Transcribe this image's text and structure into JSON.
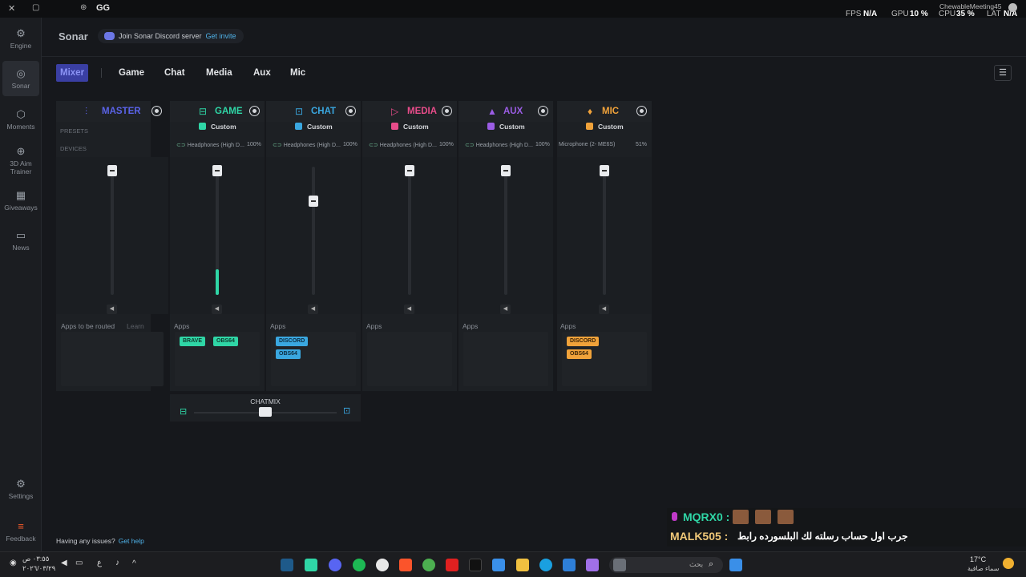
{
  "titlebar": {
    "app": "GG",
    "fps_label": "FPS",
    "fps_value": "N/A",
    "gpu_label": "GPU",
    "gpu_value": "10 %",
    "cpu_label": "CPU",
    "cpu_value": "35 %",
    "lat_label": "LAT",
    "lat_value": "N/A",
    "username": "ChewableMeeting45"
  },
  "sidebar": {
    "items": [
      {
        "label": "Engine"
      },
      {
        "label": "Sonar"
      },
      {
        "label": "Moments"
      },
      {
        "label": "3D Aim Trainer"
      },
      {
        "label": "Giveaways"
      },
      {
        "label": "News"
      },
      {
        "label": "Settings"
      },
      {
        "label": "Feedback"
      }
    ]
  },
  "header": {
    "title": "Sonar",
    "discord_text": "Join Sonar Discord server",
    "discord_link": "Get invite"
  },
  "tabs": [
    "Mixer",
    "Game",
    "Chat",
    "Media",
    "Aux",
    "Mic"
  ],
  "master": {
    "name": "MASTER",
    "presets_label": "PRESETS",
    "devices_label": "DEVICES",
    "apps_text": "Apps to be routed",
    "learn_more": "Learn More"
  },
  "channels": [
    {
      "name": "GAME",
      "color": "#2fd6a6",
      "preset": "Custom",
      "device": "Headphones (High D...",
      "volume": "100%",
      "level": 0.2,
      "apps_label": "Apps",
      "apps": [
        "BRAVE",
        "OBS64"
      ]
    },
    {
      "name": "CHAT",
      "color": "#3aa7e0",
      "preset": "Custom",
      "device": "Headphones (High D...",
      "volume": "100%",
      "level": 0.0,
      "apps_label": "Apps",
      "apps": [
        "DISCORD",
        "OBS64"
      ]
    },
    {
      "name": "MEDIA",
      "color": "#e84c8a",
      "preset": "Custom",
      "device": "Headphones (High D...",
      "volume": "100%",
      "level": 0.0,
      "apps_label": "Apps",
      "apps": []
    },
    {
      "name": "AUX",
      "color": "#9b5de5",
      "preset": "Custom",
      "device": "Headphones (High D...",
      "volume": "100%",
      "level": 0.0,
      "apps_label": "Apps",
      "apps": []
    },
    {
      "name": "MIC",
      "color": "#f0a23a",
      "preset": "Custom",
      "device": "Microphone (2- ME6S)",
      "volume": "51%",
      "level": 0.0,
      "apps_label": "Apps",
      "apps": [
        "DISCORD",
        "OBS64"
      ]
    }
  ],
  "chatmix": {
    "label": "CHATMIX",
    "balance": 0.5
  },
  "help": {
    "text": "Having any issues?",
    "link": "Get help"
  },
  "chat_overlay": {
    "line1_user": "MQRX0 :",
    "line2_user": "MALK505 :",
    "line2_message": "جرب اول حساب رسلته لك البلسورده رابط"
  },
  "taskbar": {
    "search_placeholder": "بحث",
    "weather": "17°C",
    "weather_desc": "سماء صافية",
    "time": "٠٣:٥٥ ص",
    "date": "٢٠٢٦/٠٣/٢٩",
    "lang": "ع"
  }
}
